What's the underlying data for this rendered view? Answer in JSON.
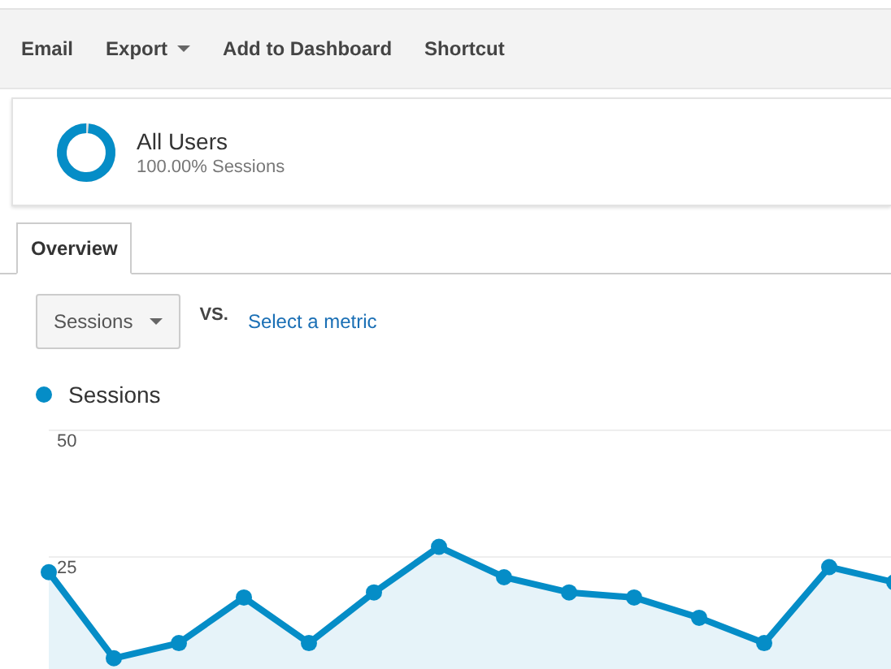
{
  "toolbar": [
    {
      "label": "Email",
      "dropdown": false
    },
    {
      "label": "Export",
      "dropdown": true
    },
    {
      "label": "Add to Dashboard",
      "dropdown": false
    },
    {
      "label": "Shortcut",
      "dropdown": false
    }
  ],
  "segment": {
    "name": "All Users",
    "share": "100.00% Sessions"
  },
  "tabs": [
    {
      "label": "Overview",
      "selected": true
    }
  ],
  "metric_picker": {
    "value": "Sessions",
    "vs": "VS.",
    "link": "Select a metric"
  },
  "chart_data": {
    "type": "area",
    "series": [
      {
        "name": "Sessions",
        "color": "#058dc7",
        "values": [
          22,
          5,
          8,
          17,
          8,
          18,
          27,
          21,
          18,
          17,
          13,
          8,
          23,
          20
        ]
      }
    ],
    "ylim": [
      0,
      50
    ],
    "yticks": [
      25,
      50
    ]
  }
}
